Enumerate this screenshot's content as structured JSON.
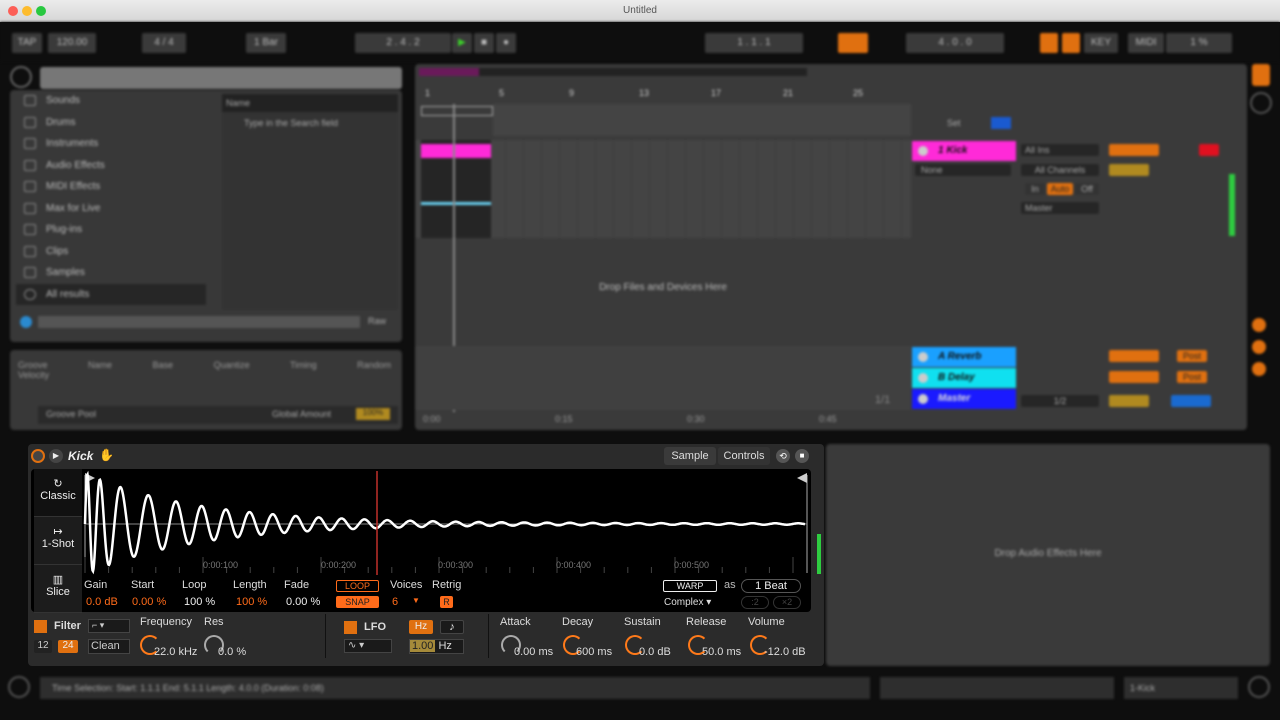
{
  "window": {
    "title": "Untitled"
  },
  "control_bar": {
    "tap": "TAP",
    "tempo": "120.00",
    "sig": "4 / 4",
    "quant": "1 Bar",
    "position": "2 . 4 . 2",
    "loop_start": "1 . 1 . 1",
    "loop_len": "4 . 0 . 0",
    "key": "KEY",
    "midi": "MIDI",
    "cpu": "1 %",
    "play_color": "#3ccf2a"
  },
  "browser": {
    "items": [
      "Sounds",
      "Drums",
      "Instruments",
      "Audio Effects",
      "MIDI Effects",
      "Max for Live",
      "Plug-ins",
      "Clips",
      "Samples",
      "All results"
    ],
    "column_header": "Name",
    "hint": "Type in the Search field",
    "raw": "Raw"
  },
  "groove": {
    "headers": [
      "Groove Name",
      "Base",
      "Quantize",
      "Timing",
      "Random",
      "Velocity"
    ],
    "pool": "Groove Pool",
    "global_amount": "Global Amount",
    "amount_value": "100%"
  },
  "arrangement": {
    "ruler": [
      "1",
      "5",
      "9",
      "13",
      "17",
      "21",
      "25"
    ],
    "time_ruler": [
      "0:00",
      "0:15",
      "0:30",
      "0:45"
    ],
    "drop_hint": "Drop Files and Devices Here",
    "set": "Set",
    "page": "1/1",
    "tracks": [
      {
        "name": "1 Kick",
        "color": "#ff2ad8"
      },
      {
        "name": "A Reverb",
        "color": "#1aa0ff"
      },
      {
        "name": "B Delay",
        "color": "#10e0f0"
      },
      {
        "name": "Master",
        "color": "#1a1aff"
      }
    ],
    "io": {
      "input": "All Ins",
      "channel": "All Channels",
      "monitor": [
        "In",
        "Auto",
        "Off"
      ],
      "output": "Master",
      "none": "None",
      "master_out": "1/2",
      "post": "Post"
    }
  },
  "device": {
    "name": "Kick",
    "tabs": [
      "Sample",
      "Controls"
    ],
    "modes": [
      "Classic",
      "1-Shot",
      "Slice"
    ],
    "time_ticks": [
      "0:00:100",
      "0:00:200",
      "0:00:300",
      "0:00:400",
      "0:00:500"
    ],
    "params": [
      {
        "label": "Gain",
        "value": "0.0 dB"
      },
      {
        "label": "Start",
        "value": "0.00 %"
      },
      {
        "label": "Loop",
        "value": "100 %"
      },
      {
        "label": "Length",
        "value": "100 %"
      },
      {
        "label": "Fade",
        "value": "0.00 %"
      }
    ],
    "loop": "LOOP",
    "snap": "SNAP",
    "voices_label": "Voices",
    "voices": "6",
    "retrig_label": "Retrig",
    "retrig": "R",
    "warp": "WARP",
    "as": "as",
    "beats": "1 Beat",
    "warp_mode": "Complex",
    "half": ":2",
    "double": "×2",
    "filter": {
      "label": "Filter",
      "slopes": [
        "12",
        "24"
      ],
      "type": "Clean",
      "freq_label": "Frequency",
      "freq": "22.0 kHz",
      "res_label": "Res",
      "res": "0.0 %"
    },
    "lfo": {
      "label": "LFO",
      "hz": "Hz",
      "note": "♪",
      "rate": "1.00",
      "unit": "Hz"
    },
    "env": [
      {
        "label": "Attack",
        "value": "0.00 ms"
      },
      {
        "label": "Decay",
        "value": "600 ms"
      },
      {
        "label": "Sustain",
        "value": "0.0 dB"
      },
      {
        "label": "Release",
        "value": "50.0 ms"
      },
      {
        "label": "Volume",
        "value": "-12.0 dB"
      }
    ]
  },
  "fx_drop": "Drop Audio Effects Here",
  "status": {
    "text": "Time Selection:  Start: 1.1.1   End: 5.1.1   Length: 4.0.0  (Duration: 0:08)",
    "track": "1-Kick"
  },
  "accent": "#ff6b1a"
}
